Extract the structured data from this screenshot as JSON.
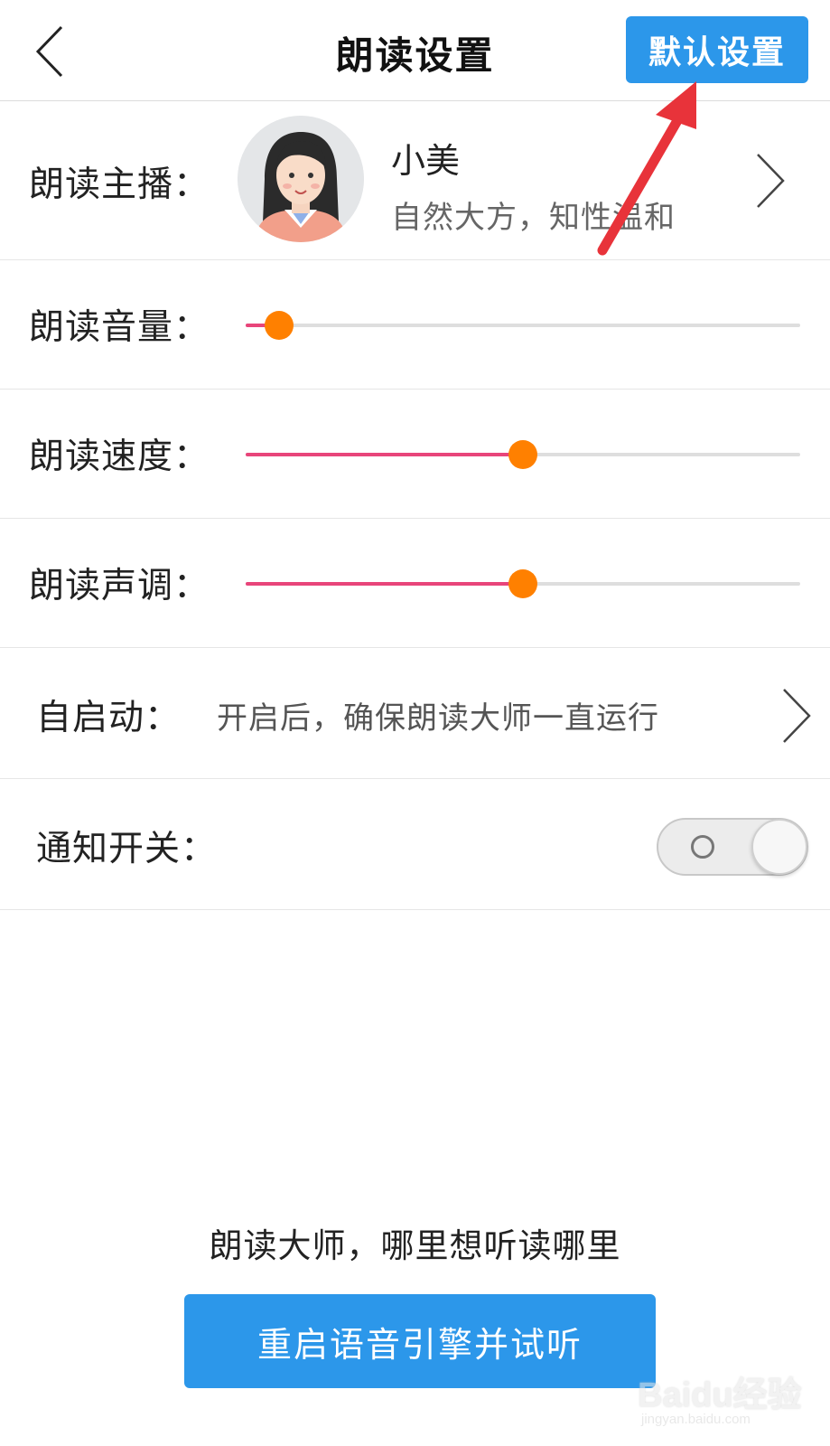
{
  "header": {
    "title": "朗读设置",
    "default_button": "默认设置"
  },
  "anchor": {
    "label": "朗读主播：",
    "name": "小美",
    "description": "自然大方，知性温和"
  },
  "volume": {
    "label": "朗读音量：",
    "value_fraction": 0.06
  },
  "speed": {
    "label": "朗读速度：",
    "value_fraction": 0.5
  },
  "pitch": {
    "label": "朗读声调：",
    "value_fraction": 0.5
  },
  "autostart": {
    "label": "自启动：",
    "description": "开启后，确保朗读大师一直运行"
  },
  "notification": {
    "label": "通知开关：",
    "enabled": false
  },
  "footer": {
    "slogan": "朗读大师，哪里想听读哪里",
    "restart_button": "重启语音引擎并试听"
  },
  "watermark": {
    "brand": "Baidu经验",
    "url": "jingyan.baidu.com"
  },
  "colors": {
    "accent_blue": "#2c97ea",
    "slider_fill": "#e8457a",
    "slider_thumb": "#ff8000",
    "annotation_arrow": "#e8333a"
  }
}
